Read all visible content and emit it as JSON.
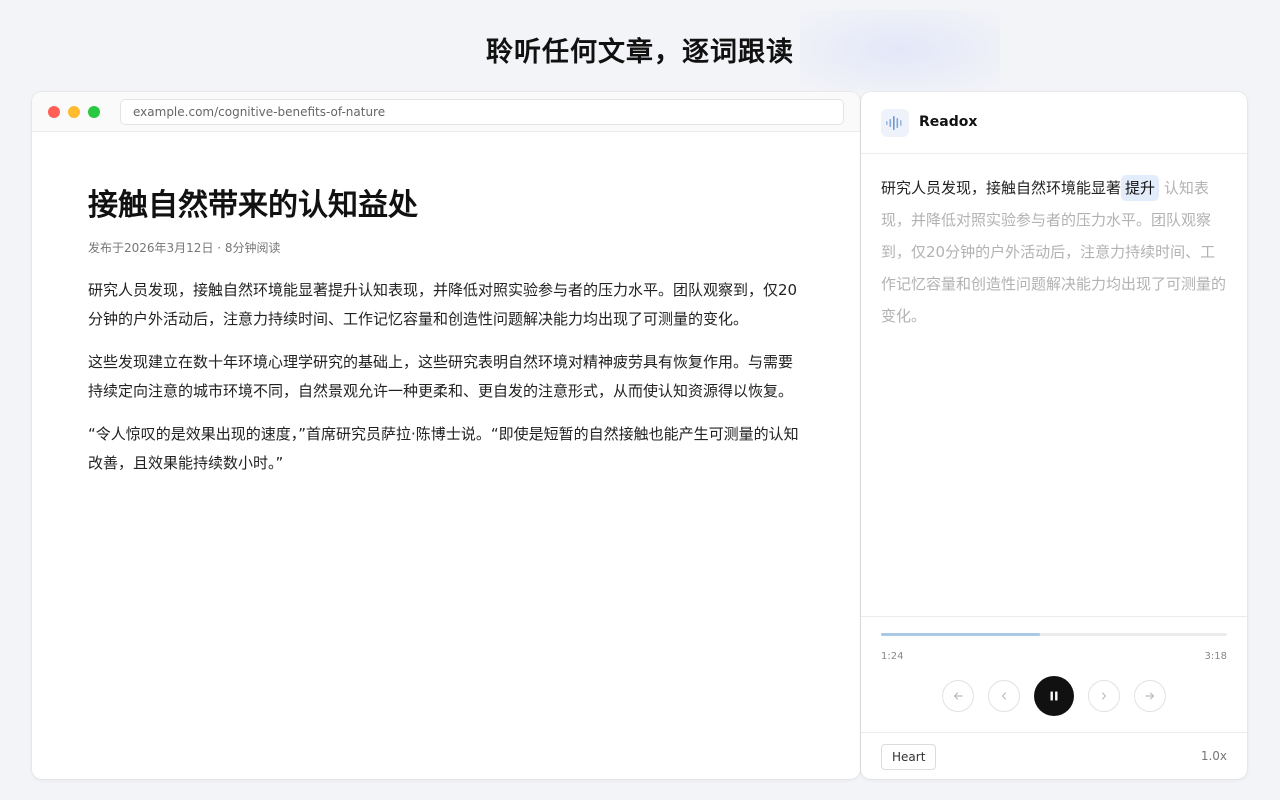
{
  "hero": {
    "title": "聆听任何文章，逐词跟读"
  },
  "browser": {
    "url": "example.com/cognitive-benefits-of-nature"
  },
  "article": {
    "title": "接触自然带来的认知益处",
    "meta": "发布于2026年3月12日 · 8分钟阅读",
    "paragraphs": [
      "研究人员发现，接触自然环境能显著提升认知表现，并降低对照实验参与者的压力水平。团队观察到，仅20分钟的户外活动后，注意力持续时间、工作记忆容量和创造性问题解决能力均出现了可测量的变化。",
      "这些发现建立在数十年环境心理学研究的基础上，这些研究表明自然环境对精神疲劳具有恢复作用。与需要持续定向注意的城市环境不同，自然景观允许一种更柔和、更自发的注意形式，从而使认知资源得以恢复。",
      "“令人惊叹的是效果出现的速度，”首席研究员萨拉·陈博士说。“即使是短暂的自然接触也能产生可测量的认知改善，且效果能持续数小时。”"
    ]
  },
  "reader": {
    "brand": "Readox",
    "logo_icon": "waveform-icon",
    "text_spoken": "研究人员发现，接触自然环境能显著",
    "text_current": "提升",
    "text_pending": "认知表现，并降低对照实验参与者的压力水平。团队观察到，仅20分钟的户外活动后，注意力持续时间、工作记忆容量和创造性问题解决能力均出现了可测量的变化。",
    "progress_fraction": 0.46,
    "time_elapsed": "1:24",
    "time_total": "3:18",
    "controls": [
      "rewind-icon",
      "previous-icon",
      "pause-icon",
      "next-icon",
      "forward-icon"
    ],
    "voice": "Heart",
    "speed": "1.0x",
    "accent_color": "#a9c9e6"
  }
}
